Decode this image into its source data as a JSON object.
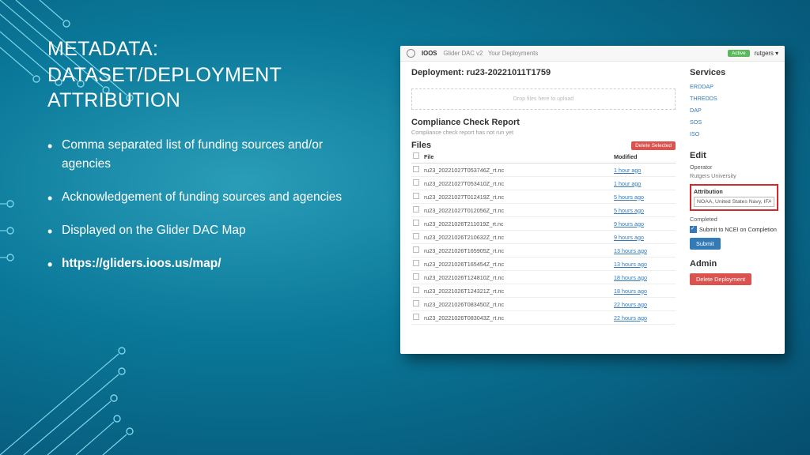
{
  "title_l1": "METADATA:",
  "title_l2": "DATASET/DEPLOYMENT",
  "title_l3": "ATTRIBUTION",
  "bullets": [
    {
      "text": "Comma separated list of funding sources and/or agencies",
      "bold": false
    },
    {
      "text": "Acknowledgement of funding sources and agencies",
      "bold": false
    },
    {
      "text": "Displayed on the Glider DAC Map",
      "bold": false
    },
    {
      "text": "https://gliders.ioos.us/map/",
      "bold": true
    }
  ],
  "screenshot": {
    "brand": "IOOS",
    "app": "Glider DAC v2",
    "nav": "Your Deployments",
    "status": "Active",
    "user": "rutgers ▾",
    "deployment_title": "Deployment: ru23-20221011T1759",
    "dropzone": "Drop files here to upload",
    "services_h": "Services",
    "services": [
      "ERDDAP",
      "THREDDS",
      "DAP",
      "SOS",
      "ISO"
    ],
    "compliance_h": "Compliance Check Report",
    "compliance_sub": "Compliance check report has not run yet",
    "files_h": "Files",
    "delete_sel": "Delete Selected",
    "cols": {
      "file": "File",
      "modified": "Modified"
    },
    "rows": [
      {
        "file": "ru23_20221027T053746Z_rt.nc",
        "mod": "1 hour ago"
      },
      {
        "file": "ru23_20221027T053410Z_rt.nc",
        "mod": "1 hour ago"
      },
      {
        "file": "ru23_20221027T012419Z_rt.nc",
        "mod": "5 hours ago"
      },
      {
        "file": "ru23_20221027T012056Z_rt.nc",
        "mod": "5 hours ago"
      },
      {
        "file": "ru23_20221026T211019Z_rt.nc",
        "mod": "9 hours ago"
      },
      {
        "file": "ru23_20221026T210632Z_rt.nc",
        "mod": "9 hours ago"
      },
      {
        "file": "ru23_20221026T165905Z_rt.nc",
        "mod": "13 hours ago"
      },
      {
        "file": "ru23_20221026T165454Z_rt.nc",
        "mod": "13 hours ago"
      },
      {
        "file": "ru23_20221026T124810Z_rt.nc",
        "mod": "18 hours ago"
      },
      {
        "file": "ru23_20221026T124321Z_rt.nc",
        "mod": "18 hours ago"
      },
      {
        "file": "ru23_20221026T083450Z_rt.nc",
        "mod": "22 hours ago"
      },
      {
        "file": "ru23_20221026T083043Z_rt.nc",
        "mod": "22 hours ago"
      }
    ],
    "edit_h": "Edit",
    "operator_lbl": "Operator",
    "operator_val": "Rutgers University",
    "attribution_lbl": "Attribution",
    "attribution_val": "NOAA, United States Navy, IFAA, OAR, AOML",
    "completed_lbl": "Completed",
    "submit_ncei_lbl": "Submit to NCEI on Completion",
    "submit_btn": "Submit",
    "admin_h": "Admin",
    "delete_deploy": "Delete Deployment"
  }
}
